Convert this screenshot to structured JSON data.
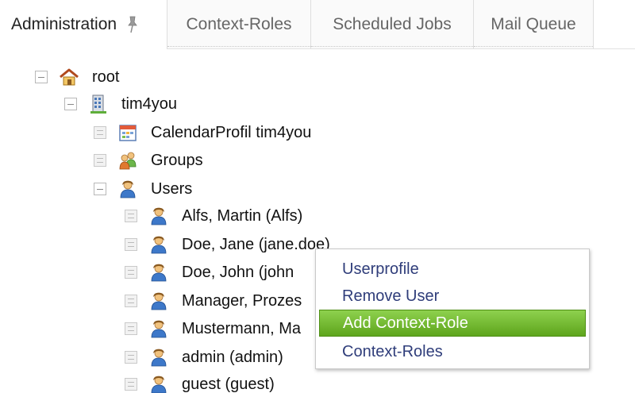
{
  "tabs": [
    {
      "label": "Administration",
      "active": true,
      "icon": "pin-icon"
    },
    {
      "label": "Context-Roles",
      "active": false
    },
    {
      "label": "Scheduled Jobs",
      "active": false
    },
    {
      "label": "Mail Queue",
      "active": false
    }
  ],
  "tree": {
    "root": {
      "label": "root",
      "icon": "home-icon",
      "expanded": true
    },
    "org": {
      "label": "tim4you",
      "icon": "building-icon",
      "expanded": true
    },
    "calendar": {
      "label": "CalendarProfil tim4you",
      "icon": "calendar-icon"
    },
    "groups": {
      "label": "Groups",
      "icon": "groups-icon"
    },
    "users": {
      "label": "Users",
      "icon": "user-icon",
      "expanded": true
    },
    "user_items": [
      {
        "label": "Alfs, Martin (Alfs)"
      },
      {
        "label": "Doe, Jane (jane.doe)"
      },
      {
        "label": "Doe, John (john"
      },
      {
        "label": "Manager, Prozes"
      },
      {
        "label": "Mustermann, Ma"
      },
      {
        "label": "admin (admin)"
      },
      {
        "label": "guest (guest)"
      }
    ]
  },
  "context_menu": {
    "items": [
      {
        "label": "Userprofile",
        "highlighted": false
      },
      {
        "label": "Remove User",
        "highlighted": false
      },
      {
        "label": "Add Context-Role",
        "highlighted": true
      },
      {
        "label": "Context-Roles",
        "highlighted": false
      }
    ]
  },
  "colors": {
    "menu_highlight": "#6cb82a",
    "menu_text": "#2f3d7a",
    "tab_inactive_text": "#666666"
  }
}
